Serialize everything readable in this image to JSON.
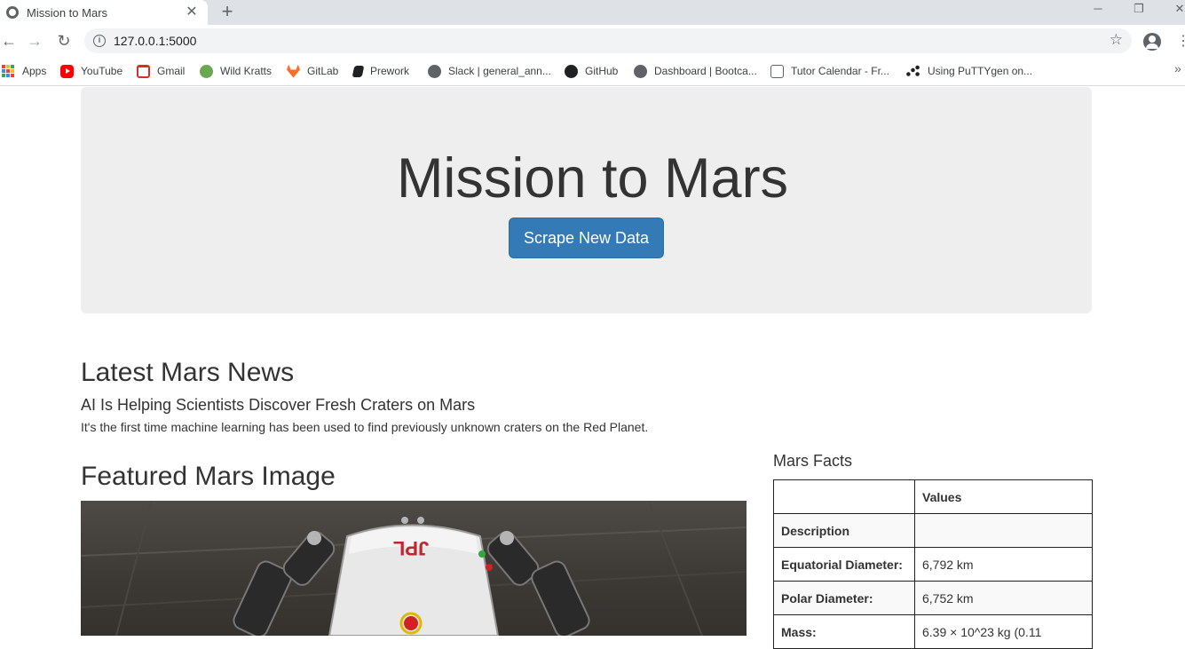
{
  "browser": {
    "tab_title": "Mission to Mars",
    "url": "127.0.0.1:5000",
    "bookmarks": [
      {
        "label": "Apps",
        "icon": "apps-grid-icon"
      },
      {
        "label": "YouTube",
        "icon": "youtube-icon"
      },
      {
        "label": "Gmail",
        "icon": "gmail-icon"
      },
      {
        "label": "Wild Kratts",
        "icon": "wild-kratts-icon"
      },
      {
        "label": "GitLab",
        "icon": "gitlab-icon"
      },
      {
        "label": "Prework",
        "icon": "prework-icon"
      },
      {
        "label": "Slack | general_ann...",
        "icon": "globe-icon"
      },
      {
        "label": "GitHub",
        "icon": "github-icon"
      },
      {
        "label": "Dashboard | Bootca...",
        "icon": "globe-icon"
      },
      {
        "label": "Tutor Calendar - Fr...",
        "icon": "calendar-icon"
      },
      {
        "label": "Using PuTTYgen on...",
        "icon": "putty-icon"
      }
    ]
  },
  "jumbotron": {
    "title": "Mission to Mars",
    "button_label": "Scrape New Data"
  },
  "news": {
    "heading": "Latest Mars News",
    "title": "AI Is Helping Scientists Discover Fresh Craters on Mars",
    "paragraph": "It's the first time machine learning has been used to find previously unknown craters on the Red Planet."
  },
  "featured": {
    "heading": "Featured Mars Image",
    "image_text": "JPL"
  },
  "facts": {
    "heading": "Mars Facts",
    "columns": [
      "",
      "Values"
    ],
    "rows": [
      {
        "label": "Description",
        "value": ""
      },
      {
        "label": "Equatorial Diameter:",
        "value": "6,792 km"
      },
      {
        "label": "Polar Diameter:",
        "value": "6,752 km"
      },
      {
        "label": "Mass:",
        "value": "6.39 × 10^23 kg (0.11"
      }
    ]
  },
  "colors": {
    "primary_button": "#337ab7",
    "jumbotron_bg": "#eeeeee"
  }
}
